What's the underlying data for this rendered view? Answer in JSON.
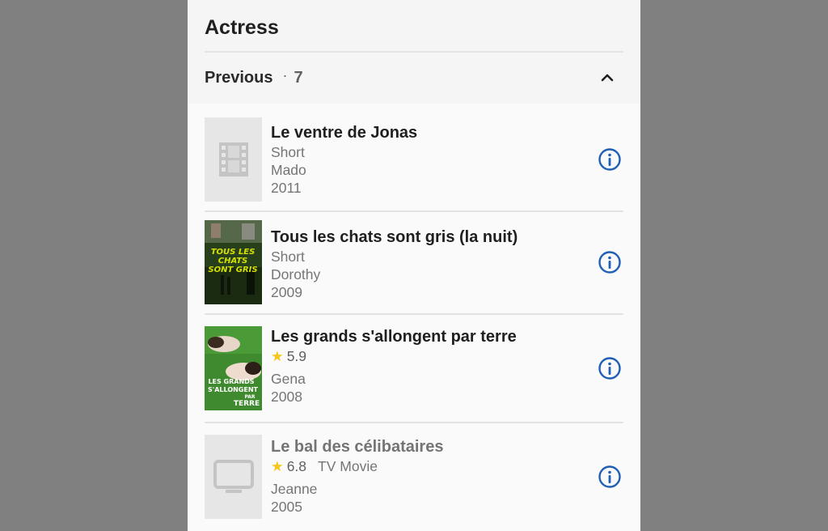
{
  "section": {
    "title": "Actress"
  },
  "group": {
    "label": "Previous",
    "separator": "·",
    "count": "7",
    "toggle_icon": "chevron-up-icon"
  },
  "colors": {
    "accent": "#1f5fb6",
    "star": "#f5c518",
    "background": "#808080",
    "panel": "#f5f5f5"
  },
  "items": [
    {
      "title": "Le ventre de Jonas",
      "type": "Short",
      "role": "Mado",
      "year": "2011",
      "poster": "film-placeholder-icon",
      "info_icon": "info-icon"
    },
    {
      "title": "Tous les chats sont gris (la nuit)",
      "type": "Short",
      "role": "Dorothy",
      "year": "2009",
      "poster": "poster-image",
      "poster_text": [
        "TOUS LES",
        "CHATS",
        "SONT GRIS"
      ],
      "info_icon": "info-icon"
    },
    {
      "title": "Les grands s'allongent par terre",
      "rating": "5.9",
      "role": "Gena",
      "year": "2008",
      "poster": "poster-image",
      "poster_text": [
        "LES GRANDS",
        "S'ALLONGENT",
        "PAR",
        "TERRE"
      ],
      "info_icon": "info-icon"
    },
    {
      "title": "Le bal des célibataires",
      "rating": "6.8",
      "type": "TV Movie",
      "role": "Jeanne",
      "year": "2005",
      "poster": "tv-placeholder-icon",
      "info_icon": "info-icon"
    }
  ]
}
